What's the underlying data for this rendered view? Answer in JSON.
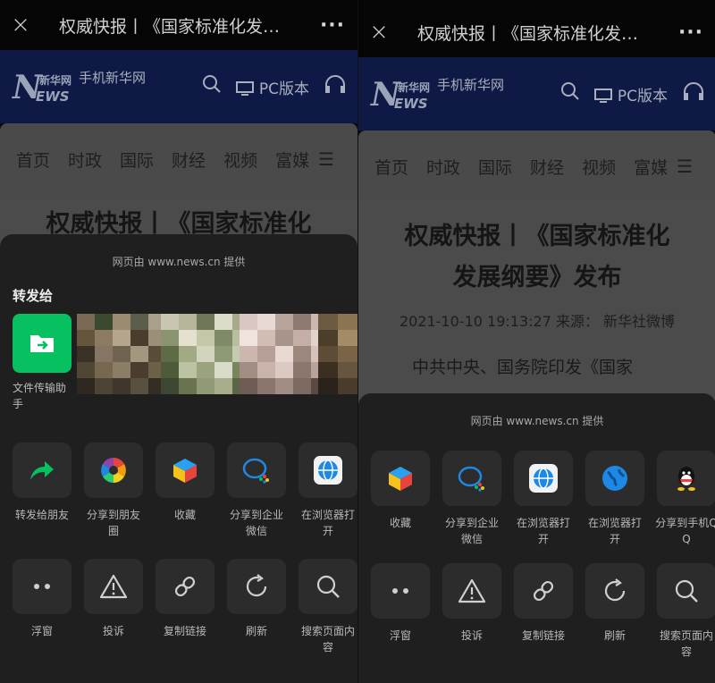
{
  "left": {
    "topbar": {
      "close_icon": "×",
      "title": "权威快报丨《国家标准化发…",
      "more_icon": "···"
    },
    "header": {
      "logo_small": "新华网",
      "logo_n": "N",
      "logo_ews": "EWS",
      "site_name": "手机新华网",
      "pc_label": "PC版本"
    },
    "nav": {
      "items": [
        "首页",
        "时政",
        "国际",
        "财经",
        "视频",
        "富媒"
      ],
      "menu_icon": "☰"
    },
    "article": {
      "title": "权威快报丨《国家标准化"
    },
    "sheet": {
      "provider": "网页由 www.news.cn 提供",
      "forward_title": "转发给",
      "contact_label": "文件传输助手",
      "row1": [
        {
          "label": "转发给朋友",
          "icon": "forward-arrow-icon"
        },
        {
          "label": "分享到朋友圈",
          "icon": "moments-icon"
        },
        {
          "label": "收藏",
          "icon": "favorite-cube-icon"
        },
        {
          "label": "分享到企业微信",
          "icon": "wecom-icon"
        },
        {
          "label": "在浏览器打开",
          "icon": "browser-icon"
        }
      ],
      "row2": [
        {
          "label": "浮窗",
          "icon": "float-window-icon"
        },
        {
          "label": "投诉",
          "icon": "warning-icon"
        },
        {
          "label": "复制链接",
          "icon": "link-icon"
        },
        {
          "label": "刷新",
          "icon": "refresh-icon"
        },
        {
          "label": "搜索页面内容",
          "icon": "search-icon"
        }
      ]
    }
  },
  "right": {
    "topbar": {
      "close_icon": "×",
      "title": "权威快报丨《国家标准化发…",
      "more_icon": "···"
    },
    "header": {
      "logo_small": "新华网",
      "logo_n": "N",
      "logo_ews": "EWS",
      "site_name": "手机新华网",
      "pc_label": "PC版本"
    },
    "nav": {
      "items": [
        "首页",
        "时政",
        "国际",
        "财经",
        "视频",
        "富媒"
      ],
      "menu_icon": "☰"
    },
    "article": {
      "title_line1": "权威快报丨《国家标准化",
      "title_line2": "发展纲要》发布",
      "meta": "2021-10-10 19:13:27 来源： 新华社微博",
      "lead": "中共中央、国务院印发《国家"
    },
    "sheet": {
      "provider": "网页由 www.news.cn 提供",
      "row1": [
        {
          "label": "收藏",
          "icon": "favorite-cube-icon"
        },
        {
          "label": "分享到企业微信",
          "icon": "wecom-icon"
        },
        {
          "label": "在浏览器打开",
          "icon": "browser-icon"
        },
        {
          "label": "在浏览器打开",
          "icon": "globe-icon"
        },
        {
          "label": "分享到手机QQ",
          "icon": "qq-icon"
        }
      ],
      "row2": [
        {
          "label": "浮窗",
          "icon": "float-window-icon"
        },
        {
          "label": "投诉",
          "icon": "warning-icon"
        },
        {
          "label": "复制链接",
          "icon": "link-icon"
        },
        {
          "label": "刷新",
          "icon": "refresh-icon"
        },
        {
          "label": "搜索页面内容",
          "icon": "search-icon"
        }
      ]
    }
  }
}
